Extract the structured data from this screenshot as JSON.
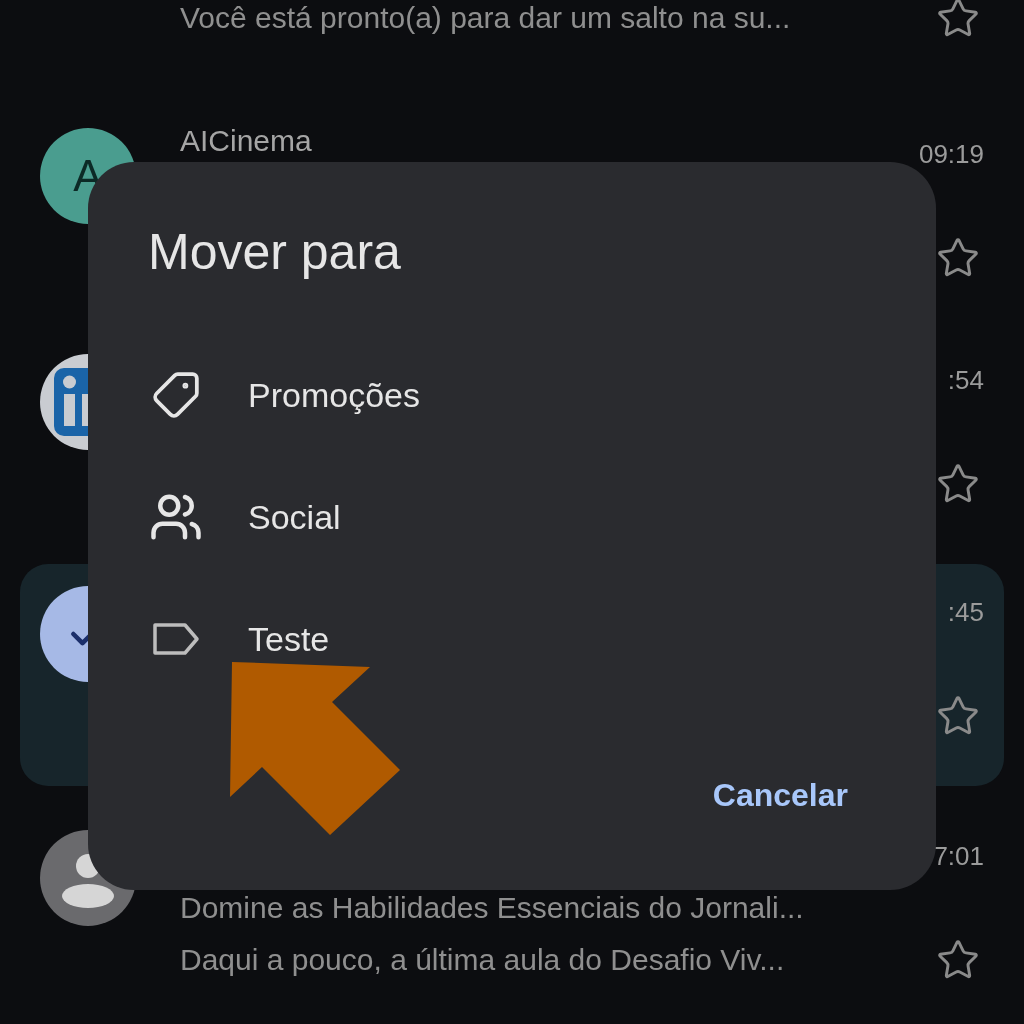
{
  "messages": [
    {
      "lines": [
        "Você está pronto(a) para dar um salto na su..."
      ],
      "starred": false,
      "selected": false
    },
    {
      "avatar": {
        "kind": "letter",
        "letter": "A"
      },
      "sender": "AICinema",
      "time": "09:19",
      "starred": false,
      "selected": false
    },
    {
      "avatar": {
        "kind": "logo"
      },
      "time": ":54",
      "starred": false,
      "selected": false
    },
    {
      "avatar": {
        "kind": "checked"
      },
      "time": ":45",
      "starred": false,
      "selected": true
    },
    {
      "avatar": {
        "kind": "person"
      },
      "time": "7:01",
      "lines": [
        "Domine as Habilidades Essenciais do Jornali...",
        "Daqui a pouco, a última aula do Desafio Viv..."
      ],
      "starred": false,
      "selected": false
    }
  ],
  "dialog": {
    "title": "Mover para",
    "options": [
      {
        "kind": "category",
        "label": "Promoções"
      },
      {
        "kind": "group",
        "label": "Social"
      },
      {
        "kind": "label",
        "label": "Teste"
      }
    ],
    "cancel": "Cancelar"
  },
  "annotation": {
    "kind": "arrow"
  }
}
